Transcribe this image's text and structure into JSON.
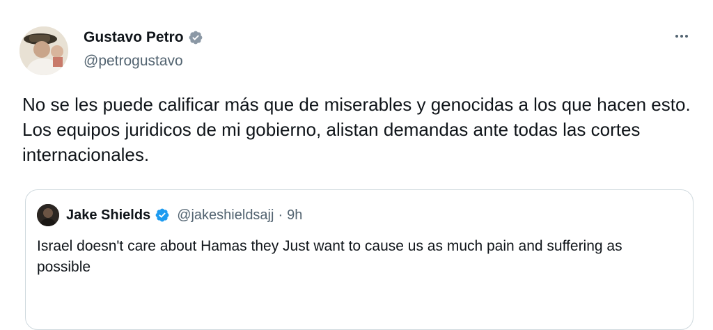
{
  "tweet": {
    "author": {
      "display_name": "Gustavo Petro",
      "handle": "@petrogustavo",
      "verified": true,
      "avatar_icon": "user-avatar"
    },
    "more_icon": "more-horizontal-icon",
    "text": "No se les puede calificar más que de miserables y genocidas a los que hacen esto. Los equipos juridicos de mi gobierno, alistan demandas ante todas las cortes internacionales.",
    "quoted": {
      "display_name": "Jake Shields",
      "handle": "@jakeshieldsajj",
      "separator": "·",
      "time": "9h",
      "verified": true,
      "text": "Israel doesn't care about Hamas they Just want to cause us as much pain and suffering as possible"
    }
  },
  "colors": {
    "primary_text": "#0f1419",
    "secondary_text": "#536471",
    "verified_badge": "#1d9bf0",
    "border": "#cfd9de"
  }
}
